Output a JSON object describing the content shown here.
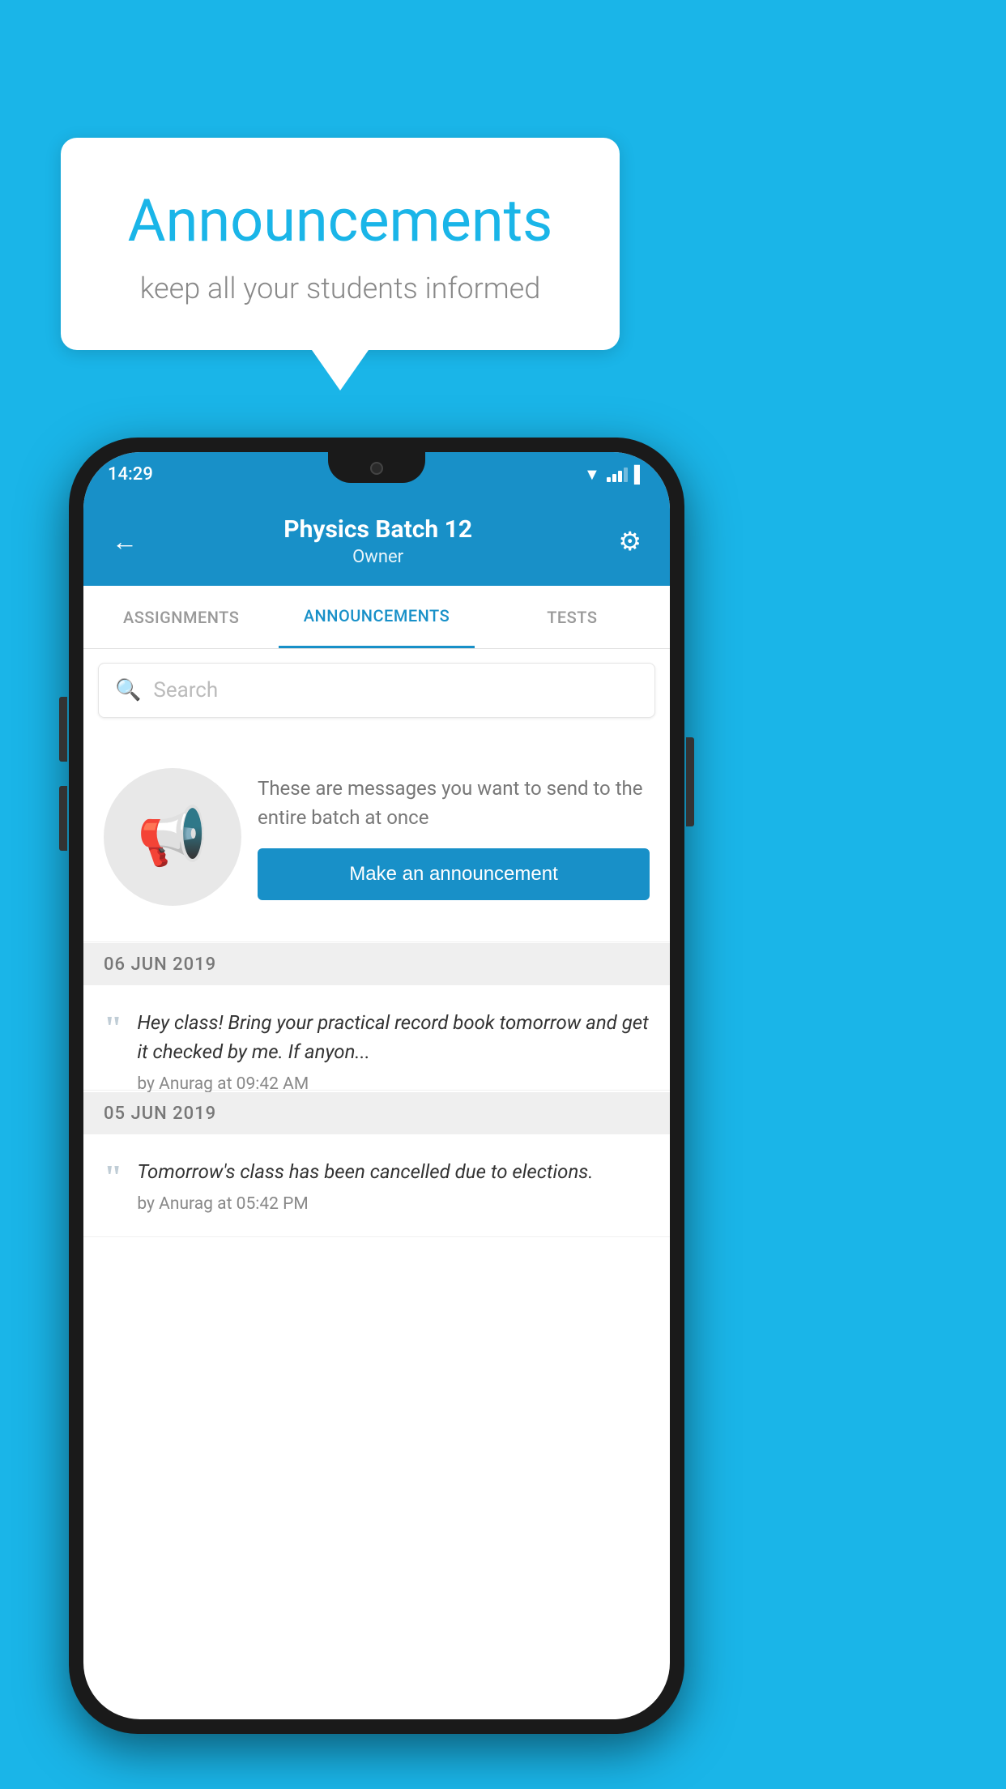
{
  "background": {
    "color": "#1ab5e8"
  },
  "speech_bubble": {
    "title": "Announcements",
    "subtitle": "keep all your students informed"
  },
  "phone": {
    "status_bar": {
      "time": "14:29"
    },
    "header": {
      "title": "Physics Batch 12",
      "subtitle": "Owner",
      "back_label": "←",
      "settings_label": "⚙"
    },
    "tabs": [
      {
        "label": "ASSIGNMENTS",
        "active": false
      },
      {
        "label": "ANNOUNCEMENTS",
        "active": true
      },
      {
        "label": "TESTS",
        "active": false
      }
    ],
    "search": {
      "placeholder": "Search"
    },
    "promo": {
      "description": "These are messages you want to send to the entire batch at once",
      "button_label": "Make an announcement"
    },
    "announcements": [
      {
        "date": "06  JUN  2019",
        "message": "Hey class! Bring your practical record book tomorrow and get it checked by me. If anyon...",
        "meta": "by Anurag at 09:42 AM"
      },
      {
        "date": "05  JUN  2019",
        "message": "Tomorrow's class has been cancelled due to elections.",
        "meta": "by Anurag at 05:42 PM"
      }
    ]
  }
}
